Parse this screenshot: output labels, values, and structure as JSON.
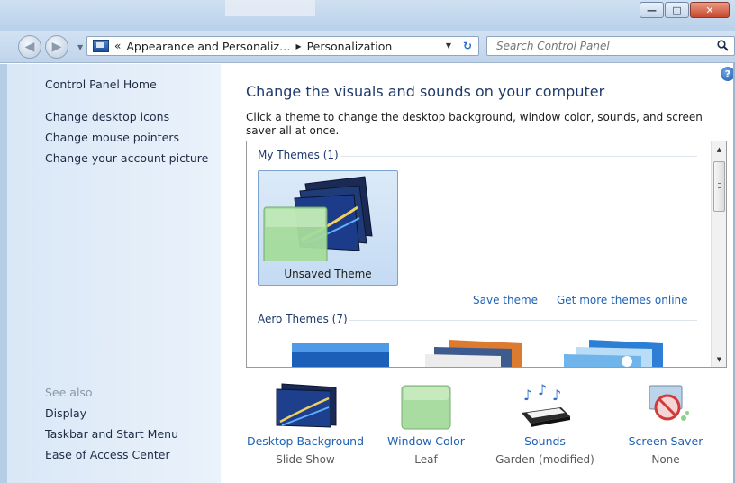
{
  "window": {
    "minimize_glyph": "—",
    "maximize_glyph": "□",
    "close_glyph": "✕"
  },
  "nav": {
    "back_icon": "back-arrow-icon",
    "forward_icon": "forward-arrow-icon"
  },
  "address": {
    "chevrons": "«",
    "crumb_1": "Appearance and Personaliz…",
    "separator": "▸",
    "crumb_2": "Personalization"
  },
  "search": {
    "placeholder": "Search Control Panel"
  },
  "sidebar": {
    "home": "Control Panel Home",
    "links": [
      "Change desktop icons",
      "Change mouse pointers",
      "Change your account picture"
    ],
    "see_also_label": "See also",
    "see_also": [
      "Display",
      "Taskbar and Start Menu",
      "Ease of Access Center"
    ]
  },
  "main": {
    "help": "?",
    "title": "Change the visuals and sounds on your computer",
    "description": "Click a theme to change the desktop background, window color, sounds, and screen saver all at once.",
    "my_themes_label": "My Themes (1)",
    "selected_theme": "Unsaved Theme",
    "save_theme": "Save theme",
    "get_more_themes": "Get more themes online",
    "aero_themes_label": "Aero Themes (7)"
  },
  "bottom": [
    {
      "name": "Desktop Background",
      "value": "Slide Show",
      "icon": "desktop-background-icon"
    },
    {
      "name": "Window Color",
      "value": "Leaf",
      "icon": "window-color-icon"
    },
    {
      "name": "Sounds",
      "value": "Garden (modified)",
      "icon": "sounds-icon"
    },
    {
      "name": "Screen Saver",
      "value": "None",
      "icon": "screen-saver-icon"
    }
  ],
  "colors": {
    "link": "#1f62b5",
    "title": "#1e3a6b",
    "sidebar_bg": "#dfeaf7",
    "leaf_green": "#9fd69a"
  }
}
